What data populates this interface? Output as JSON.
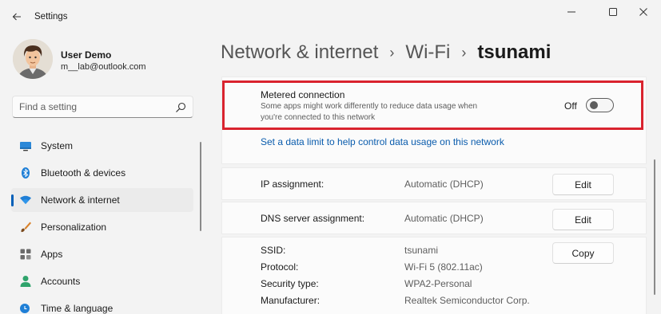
{
  "window": {
    "title": "Settings"
  },
  "user": {
    "name": "User Demo",
    "email": "m__lab@outlook.com"
  },
  "search": {
    "placeholder": "Find a setting"
  },
  "sidebar": {
    "items": [
      {
        "label": "System",
        "icon": "system-icon"
      },
      {
        "label": "Bluetooth & devices",
        "icon": "bluetooth-icon"
      },
      {
        "label": "Network & internet",
        "icon": "wifi-icon",
        "active": true
      },
      {
        "label": "Personalization",
        "icon": "brush-icon"
      },
      {
        "label": "Apps",
        "icon": "apps-icon"
      },
      {
        "label": "Accounts",
        "icon": "person-icon"
      },
      {
        "label": "Time & language",
        "icon": "clock-icon"
      }
    ]
  },
  "breadcrumb": {
    "items": [
      "Network & internet",
      "Wi-Fi"
    ],
    "current": "tsunami",
    "separator": "›"
  },
  "metered": {
    "title": "Metered connection",
    "description": "Some apps might work differently to reduce data usage when you're connected to this network",
    "state_label": "Off",
    "enabled": false,
    "link": "Set a data limit to help control data usage on this network"
  },
  "ip": {
    "label": "IP assignment:",
    "value": "Automatic (DHCP)",
    "button": "Edit"
  },
  "dns": {
    "label": "DNS server assignment:",
    "value": "Automatic (DHCP)",
    "button": "Edit"
  },
  "props": {
    "button": "Copy",
    "rows": [
      {
        "label": "SSID:",
        "value": "tsunami"
      },
      {
        "label": "Protocol:",
        "value": "Wi-Fi 5 (802.11ac)"
      },
      {
        "label": "Security type:",
        "value": "WPA2-Personal"
      },
      {
        "label": "Manufacturer:",
        "value": "Realtek Semiconductor Corp."
      }
    ]
  },
  "colors": {
    "accent": "#005fb8",
    "link": "#0a5cad",
    "highlight": "#d9232e"
  }
}
